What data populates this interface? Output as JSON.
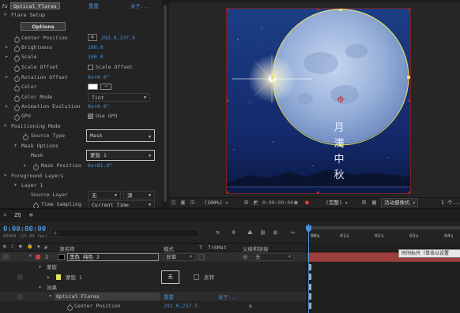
{
  "fx_panel": {
    "fx_glyph": "fx",
    "effect_name": "Optical Flares",
    "reset": "重置",
    "about": "关于...",
    "flare_setup": "Flare Setup",
    "options_button": "Options",
    "props": [
      {
        "label": "Center Position",
        "value": "292.0,237.5"
      },
      {
        "label": "Brightness",
        "value": "100.0"
      },
      {
        "label": "Scale",
        "value": "100.0"
      },
      {
        "label": "Scale Offset",
        "value": "Scale Offset"
      },
      {
        "label": "Rotation Offset",
        "value": "0x+0.0°"
      },
      {
        "label": "Color",
        "value": ""
      },
      {
        "label": "Color Mode",
        "value": "Tint"
      },
      {
        "label": "Animation Evolution",
        "value": "0x+0.0°"
      },
      {
        "label": "GPU",
        "value": "Use GPU"
      }
    ],
    "positioning_mode": "Positioning Mode",
    "source_type_label": "Source Type",
    "source_type_value": "Mask",
    "mask_options": "Mask Options",
    "mask_label": "Mask",
    "mask_value": "蒙版 1",
    "mask_position_label": "Mask Position",
    "mask_position_value": "0x+81.0°",
    "foreground_layers": "Foreground Layers",
    "layer1": "Layer 1",
    "source_layer_label": "Source Layer",
    "source_layer_value": "无",
    "source_layer_value2": "源",
    "time_sampling_label": "Time Sampling",
    "time_sampling_value": "Current Time"
  },
  "viewer": {
    "poem_chars": [
      "月",
      "满",
      "中",
      "秋"
    ],
    "colors": {
      "sky_top": "#1c3f86",
      "sky_bottom": "#0b1a44",
      "mask": "#e8e35a"
    },
    "zoom": "(100%)",
    "timecode": "0:00:00:00",
    "quality": "(完整)",
    "camera": "活动摄像机",
    "views": "1 个..."
  },
  "timeline": {
    "comp_name": "ZQ",
    "timecode": "0:00:00:00",
    "fps": "00000 (25.00 fps)",
    "search_placeholder": "ρ.",
    "col_source": "源名称",
    "col_mode": "模式",
    "col_t": "T",
    "col_trkmat": "TrkMat",
    "col_parent": "父级和链接",
    "layer_num": "1",
    "layer_name": "黑色 纯色 2",
    "layer_mode": "屏幕",
    "layer_parent": "无",
    "masks_group": "蒙版",
    "mask1": "蒙版 1",
    "mask_mode": "无",
    "mask_invert": "反转",
    "effects_group": "效果",
    "effect_name": "Optical Flares",
    "effect_reset": "重置",
    "effect_about": "关于...",
    "center_pos_label": "Center Position",
    "center_pos_value": "292.0,237.5",
    "ruler": [
      "00s",
      "01s",
      "02s",
      "03s",
      "04s"
    ],
    "tooltip": "时间标尺（单击以设置​"
  }
}
